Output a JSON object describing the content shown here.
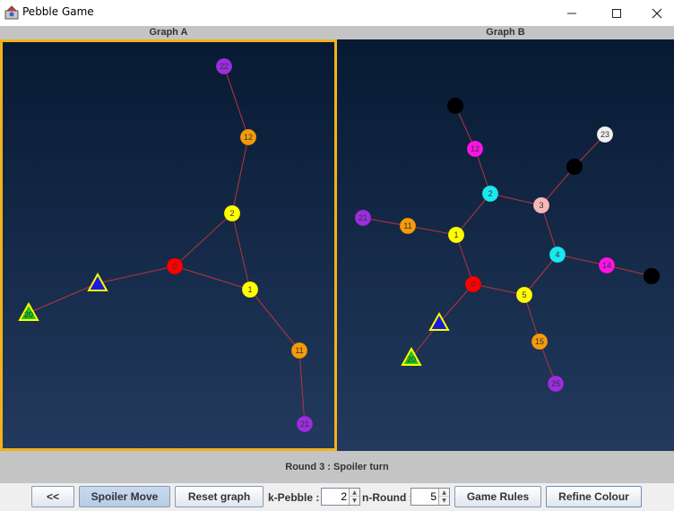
{
  "window": {
    "title": "Pebble Game",
    "app_icon": "pebble-game-app-icon",
    "minimize_icon": "minimize-icon",
    "maximize_icon": "maximize-icon",
    "close_icon": "close-icon"
  },
  "panels": {
    "a_title": "Graph A",
    "b_title": "Graph B"
  },
  "status": "Round 3 : Spoiler turn",
  "toolbar": {
    "back_label": "<<",
    "spoiler_move_label": "Spoiler Move",
    "reset_label": "Reset graph",
    "k_pebble_label": "k-Pebble :",
    "k_pebble_value": "2",
    "n_round_label": "n-Round :",
    "n_round_value": "5",
    "rules_label": "Game Rules",
    "refine_label": "Refine Colour"
  },
  "colors": {
    "selected_border": "#f2b21a",
    "edge": "#b8353a",
    "purple": "#9b2ee0",
    "orange": "#f59a0b",
    "yellow": "#ffff00",
    "red": "#ff0000",
    "cyan": "#19e8f0",
    "magenta": "#ff13e6",
    "pink": "#f7b8b8",
    "white": "#f0f0f0",
    "black": "#000000",
    "green": "#1ec31e",
    "blue": "#1a1adf"
  },
  "graphA": {
    "nodes": [
      {
        "id": "22",
        "label": "22",
        "shape": "circle",
        "color": "purple"
      },
      {
        "id": "12",
        "label": "12",
        "shape": "circle",
        "color": "orange"
      },
      {
        "id": "2",
        "label": "2",
        "shape": "circle",
        "color": "yellow"
      },
      {
        "id": "0",
        "label": "0",
        "shape": "circle",
        "color": "red"
      },
      {
        "id": "1",
        "label": "1",
        "shape": "circle",
        "color": "yellow"
      },
      {
        "id": "11",
        "label": "11",
        "shape": "circle",
        "color": "orange"
      },
      {
        "id": "21",
        "label": "21",
        "shape": "circle",
        "color": "purple"
      },
      {
        "id": "tri-blue",
        "label": "",
        "shape": "triangle",
        "color": "blue"
      },
      {
        "id": "20",
        "label": "20",
        "shape": "triangle",
        "color": "green"
      }
    ],
    "edges": [
      [
        "22",
        "12"
      ],
      [
        "12",
        "2"
      ],
      [
        "2",
        "0"
      ],
      [
        "2",
        "1"
      ],
      [
        "0",
        "1"
      ],
      [
        "0",
        "tri-blue"
      ],
      [
        "tri-blue",
        "20"
      ],
      [
        "1",
        "11"
      ],
      [
        "11",
        "21"
      ]
    ]
  },
  "graphB": {
    "nodes": [
      {
        "id": "blackTop",
        "label": "",
        "shape": "circle",
        "color": "black"
      },
      {
        "id": "12",
        "label": "12",
        "shape": "circle",
        "color": "magenta"
      },
      {
        "id": "23",
        "label": "23",
        "shape": "circle",
        "color": "white"
      },
      {
        "id": "blackMid",
        "label": "",
        "shape": "circle",
        "color": "black"
      },
      {
        "id": "2",
        "label": "2",
        "shape": "circle",
        "color": "cyan"
      },
      {
        "id": "3",
        "label": "3",
        "shape": "circle",
        "color": "pink"
      },
      {
        "id": "21",
        "label": "21",
        "shape": "circle",
        "color": "purple"
      },
      {
        "id": "11",
        "label": "11",
        "shape": "circle",
        "color": "orange"
      },
      {
        "id": "1",
        "label": "1",
        "shape": "circle",
        "color": "yellow"
      },
      {
        "id": "4",
        "label": "4",
        "shape": "circle",
        "color": "cyan"
      },
      {
        "id": "14",
        "label": "14",
        "shape": "circle",
        "color": "magenta"
      },
      {
        "id": "blackRight",
        "label": "",
        "shape": "circle",
        "color": "black"
      },
      {
        "id": "0",
        "label": "0",
        "shape": "circle",
        "color": "red"
      },
      {
        "id": "5",
        "label": "5",
        "shape": "circle",
        "color": "yellow"
      },
      {
        "id": "tri-blue",
        "label": "",
        "shape": "triangle",
        "color": "blue"
      },
      {
        "id": "15",
        "label": "15",
        "shape": "circle",
        "color": "orange"
      },
      {
        "id": "20",
        "label": "20",
        "shape": "triangle",
        "color": "green"
      },
      {
        "id": "25",
        "label": "25",
        "shape": "circle",
        "color": "purple"
      }
    ],
    "edges": [
      [
        "blackTop",
        "12"
      ],
      [
        "12",
        "2"
      ],
      [
        "2",
        "3"
      ],
      [
        "2",
        "1"
      ],
      [
        "3",
        "blackMid"
      ],
      [
        "blackMid",
        "23"
      ],
      [
        "3",
        "4"
      ],
      [
        "21",
        "11"
      ],
      [
        "11",
        "1"
      ],
      [
        "1",
        "0"
      ],
      [
        "0",
        "5"
      ],
      [
        "5",
        "4"
      ],
      [
        "4",
        "14"
      ],
      [
        "14",
        "blackRight"
      ],
      [
        "0",
        "tri-blue"
      ],
      [
        "tri-blue",
        "20"
      ],
      [
        "5",
        "15"
      ],
      [
        "15",
        "25"
      ]
    ]
  }
}
